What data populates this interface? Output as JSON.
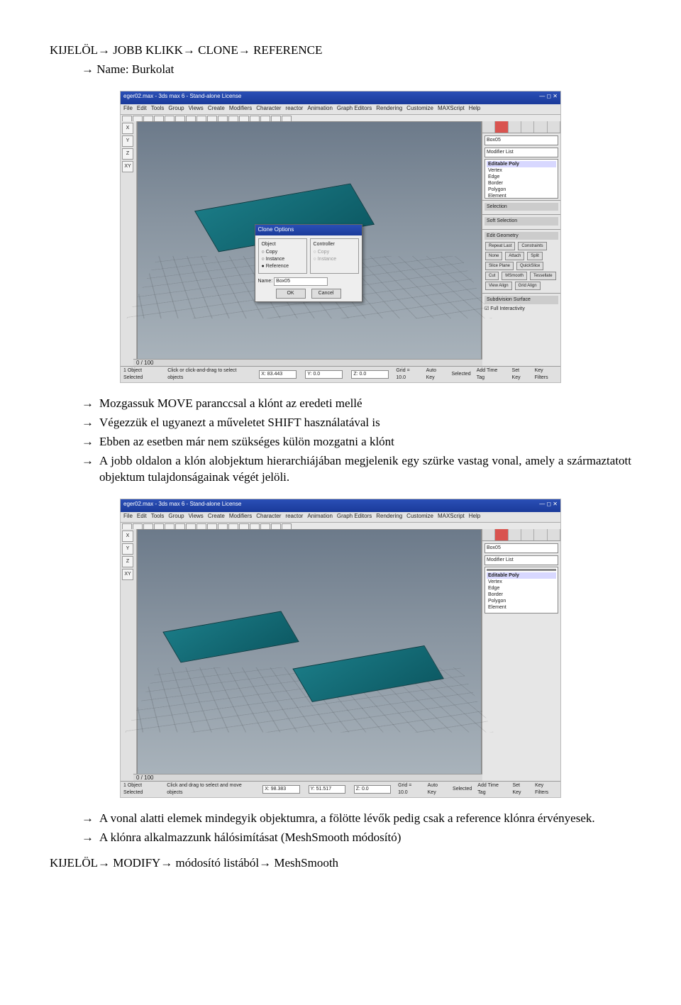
{
  "heading_top": "KIJELÖL→ JOBB KLIKK→ CLONE→ REFERENCE",
  "sub1": "→ Name: Burkolat",
  "screenshot1": {
    "title": "eger02.max - 3ds max 6 - Stand-alone License",
    "menus": [
      "File",
      "Edit",
      "Tools",
      "Group",
      "Views",
      "Create",
      "Modifiers",
      "Character",
      "reactor",
      "Animation",
      "Graph Editors",
      "Rendering",
      "Customize",
      "MAXScript",
      "Help"
    ],
    "axes": [
      "X",
      "Y",
      "Z",
      "XY"
    ],
    "panel_name": "Box05",
    "modifier_list": "Modifier List",
    "stack_header": "Editable Poly",
    "stack_items": [
      "Vertex",
      "Edge",
      "Border",
      "Polygon",
      "Element"
    ],
    "rollout_selection": "Selection",
    "rollout_softsel": "Soft Selection",
    "rollout_editgeo": "Edit Geometry",
    "rollout_btns": [
      "Repeat Last",
      "Constraints",
      "None",
      "Attach",
      "Split",
      "Slice Plane",
      "QuickSlice",
      "Cut",
      "MSmooth",
      "Tessellate",
      "View Align",
      "Grid Align"
    ],
    "subobj": "Subdivision Surface",
    "fullint": "Full Interactivity",
    "status_sel": "1 Object Selected",
    "status_hint": "Click or click-and-drag to select objects",
    "coord_x": "X: 83.443",
    "coord_y": "Y: 0.0",
    "coord_z": "Z: 0.0",
    "grid": "Grid = 10.0",
    "autokey": "Auto Key",
    "setkey": "Set Key",
    "selected": "Selected",
    "keyfilters": "Key Filters",
    "addtimetag": "Add Time Tag",
    "timeslider": "0 / 100",
    "dialog": {
      "title": "Clone Options",
      "group_obj": "Object",
      "group_ctrl": "Controller",
      "copy": "Copy",
      "instance": "Instance",
      "reference": "Reference",
      "name_label": "Name:",
      "name_value": "Box05",
      "ok": "OK",
      "cancel": "Cancel"
    }
  },
  "bullets_mid": [
    "Mozgassuk MOVE paranccsal a klónt az eredeti mellé",
    "Végezzük el ugyanezt a műveletet SHIFT használatával is",
    "Ebben az esetben már nem szükséges külön mozgatni a klónt",
    "A jobb oldalon a klón alobjektum hierarchiájában megjelenik egy szürke vastag vonal, amely a származtatott objektum tulajdonságainak végét jelöli."
  ],
  "screenshot2": {
    "title": "eger02.max - 3ds max 6 - Stand-alone License",
    "menus": [
      "File",
      "Edit",
      "Tools",
      "Group",
      "Views",
      "Create",
      "Modifiers",
      "Character",
      "reactor",
      "Animation",
      "Graph Editors",
      "Rendering",
      "Customize",
      "MAXScript",
      "Help"
    ],
    "axes": [
      "X",
      "Y",
      "Z",
      "XY"
    ],
    "panel_name": "Box05",
    "modifier_list": "Modifier List",
    "stack_header": "Editable Poly",
    "stack_items": [
      "Vertex",
      "Edge",
      "Border",
      "Polygon",
      "Element"
    ],
    "status_sel": "1 Object Selected",
    "status_hint": "Click and drag to select and move objects",
    "coord_x": "X: 98.383",
    "coord_y": "Y: 51.517",
    "coord_z": "Z: 0.0",
    "grid": "Grid = 10.0",
    "autokey": "Auto Key",
    "setkey": "Set Key",
    "selected": "Selected",
    "keyfilters": "Key Filters",
    "addtimetag": "Add Time Tag",
    "timeslider": "0 / 100"
  },
  "bullets_bottom": [
    "A vonal alatti elemek mindegyik objektumra, a fölötte lévők pedig csak a reference klónra érvényesek.",
    "A klónra alkalmazzunk hálósimításat (MeshSmooth módosító)"
  ],
  "heading_bottom": "KIJELÖL→ MODIFY→ módosító listából→ MeshSmooth"
}
